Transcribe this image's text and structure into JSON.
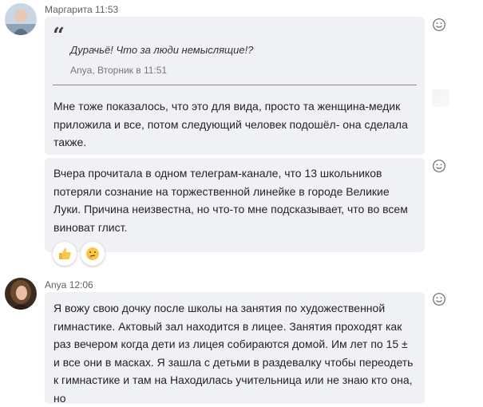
{
  "messages": [
    {
      "author": "Маргарита",
      "time": "11:53",
      "quote": {
        "text": "Дурачьё! Что за люди немыслящие!?",
        "author_time": "Anya, Вторник в 11:51"
      },
      "text": "Мне тоже показалось, что это для вида, просто та женщина-медик приложила и все, потом следующий человек подошёл- она сделала также."
    },
    {
      "text": "Вчера прочитала в одном телеграм-канале, что 13 школьников потеряли сознание на торжественной линейке в городе Великие Луки. Причина неизвестна, но что-то мне подсказывает, что во всем виноват глист.",
      "reactions": [
        "thumbs-up",
        "thinking"
      ]
    },
    {
      "author": "Anya",
      "time": "12:06",
      "text": "Я вожу свою дочку после школы на занятия по художественной гимнастике. Актовый зал находится в лицее. Занятия проходят как раз вечером когда дети из лицея собираются домой. Им лет по 15 ± и все они в масках. Я зашла с детьми в раздевалку чтобы переодеть к гимнастике и там на Находилась учительница или не знаю кто она, но"
    }
  ],
  "icons": {
    "react_button": "smiley-icon",
    "quote_mark": "quote-icon"
  },
  "colors": {
    "bubble_bg": "#f0f1f5",
    "meta_text": "#616161",
    "text": "#242424"
  }
}
